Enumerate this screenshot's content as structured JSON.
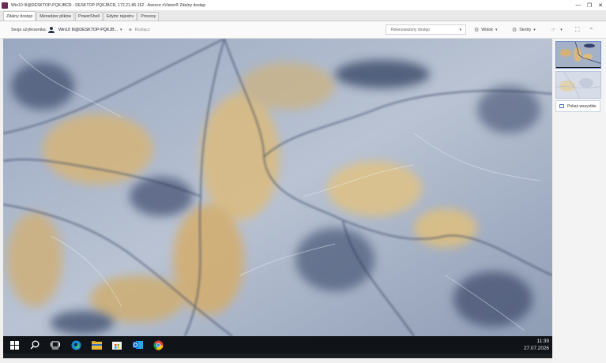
{
  "window": {
    "title": "Win10 III@DESKTOP-PQKJBCR - DESKTOP-PQKJBCR, 172.21.86.152 - Axence nVision® Zdalny dostęp",
    "controls": [
      "minimize-icon",
      "restore-icon",
      "close-icon"
    ]
  },
  "tabs": [
    {
      "label": "Zdalny dostęp",
      "active": true
    },
    {
      "label": "Menedżer plików",
      "active": false
    },
    {
      "label": "PowerShell",
      "active": false
    },
    {
      "label": "Edytor rejestru",
      "active": false
    },
    {
      "label": "Procesy",
      "active": false
    }
  ],
  "toolbar": {
    "session_label": "Sesja użytkownika:",
    "session_value": "Win10 III@DESKTOP-PQKJB...",
    "disconnect_label": "Rozłącz",
    "quality_value": "Równoważony dostęp",
    "view_label": "Widok",
    "shortcuts_label": "Skróty"
  },
  "remote": {
    "clock_time": "11:39",
    "clock_date": "27.07.2026",
    "taskbar_icons": [
      "windows-start-icon",
      "search-icon",
      "task-view-icon",
      "edge-icon",
      "file-explorer-icon",
      "store-icon",
      "outlook-icon",
      "chrome-icon"
    ]
  },
  "side_panel": {
    "show_all_label": "Pokaż wszystkie"
  },
  "colors": {
    "accent": "#4a6fb0",
    "taskbar": "#101418",
    "app_icon": "#6b2a5a"
  }
}
